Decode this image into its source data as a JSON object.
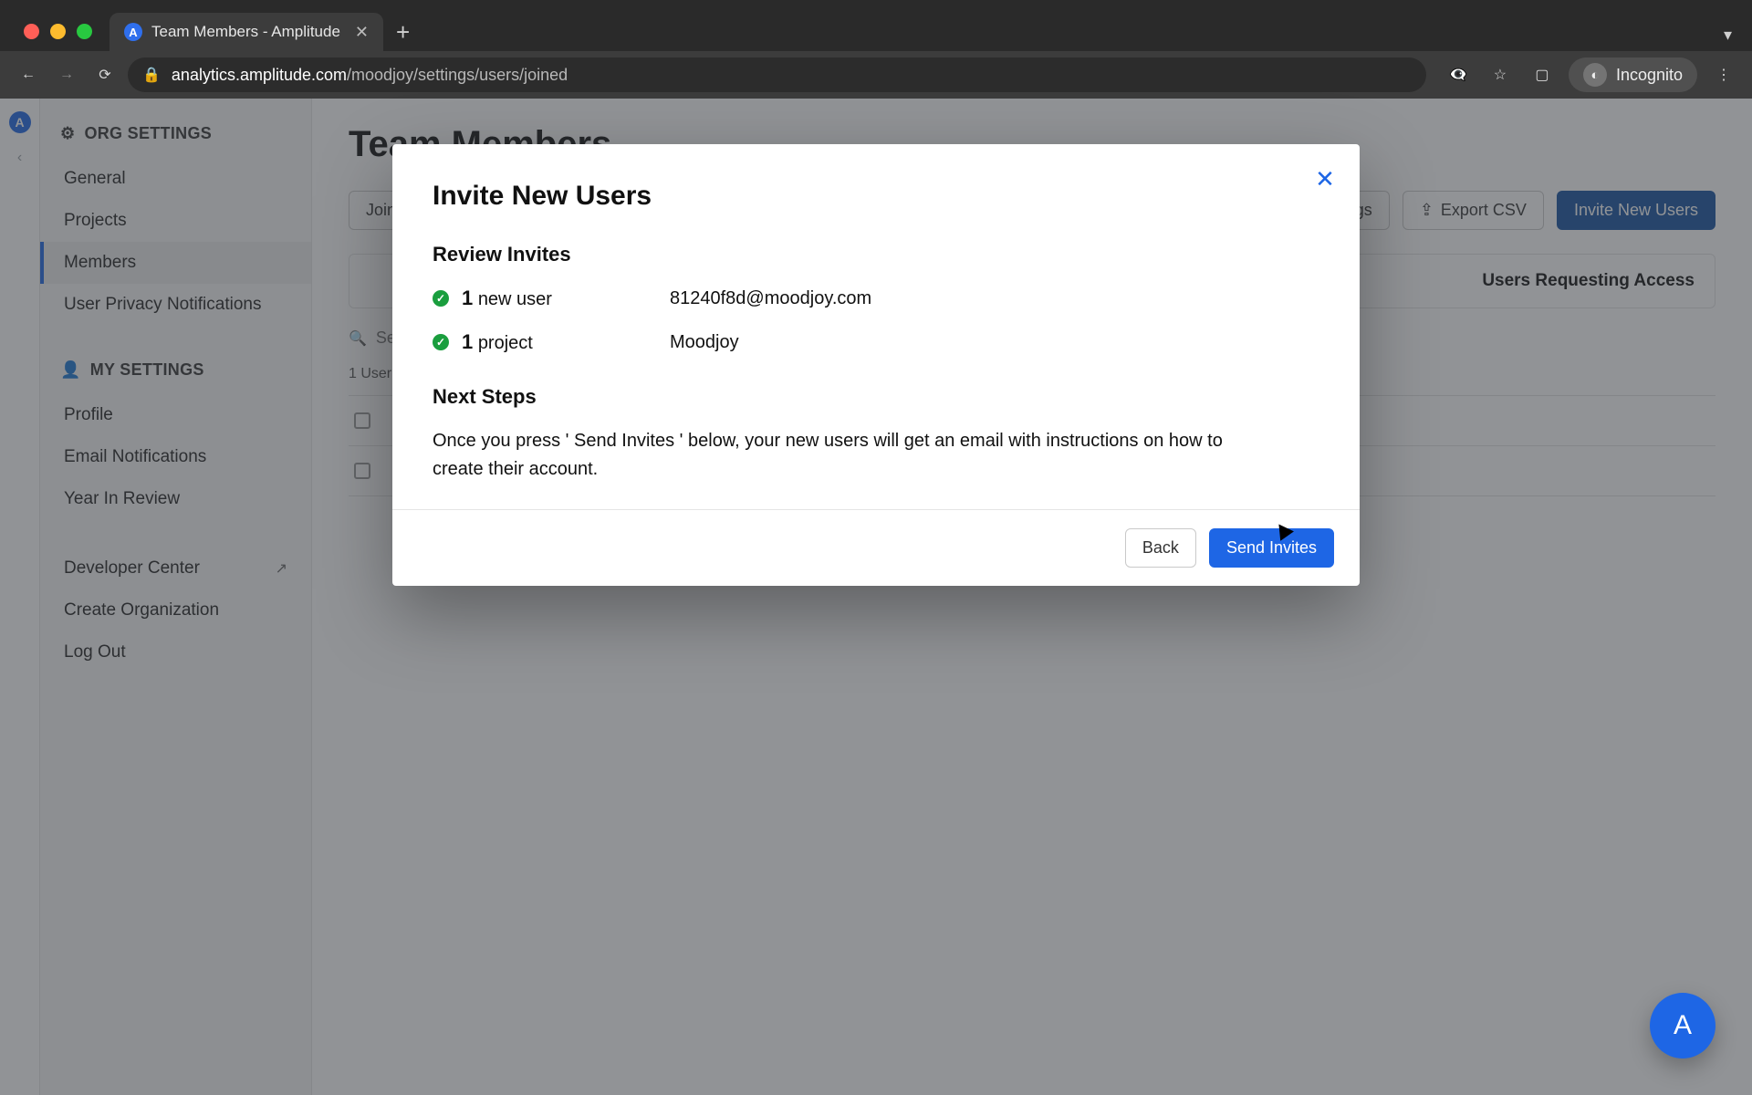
{
  "window": {
    "tab_title": "Team Members - Amplitude",
    "url_host": "analytics.amplitude.com",
    "url_path": "/moodjoy/settings/users/joined",
    "incognito_label": "Incognito"
  },
  "sidebar": {
    "org_header": "ORG SETTINGS",
    "my_header": "MY SETTINGS",
    "items_org": [
      "General",
      "Projects",
      "Members",
      "User Privacy Notifications"
    ],
    "items_my": [
      "Profile",
      "Email Notifications",
      "Year In Review"
    ],
    "items_footer": [
      "Developer Center",
      "Create Organization",
      "Log Out"
    ]
  },
  "main": {
    "title": "Team Members",
    "joined_tab": "Joined",
    "settings_btn": "Settings",
    "export_btn": "Export CSV",
    "invite_btn": "Invite New Users",
    "panel_header": "Users Requesting Access",
    "user_count_label": "1 User",
    "search_placeholder": "Search"
  },
  "modal": {
    "title": "Invite New Users",
    "review_header": "Review Invites",
    "rows": [
      {
        "count": "1",
        "label": "new user",
        "value": "81240f8d@moodjoy.com"
      },
      {
        "count": "1",
        "label": "project",
        "value": "Moodjoy"
      }
    ],
    "next_header": "Next Steps",
    "next_body": "Once you press ' Send Invites ' below, your new users will get an email with instructions on how to create their account.",
    "back": "Back",
    "send": "Send Invites"
  },
  "colors": {
    "accent": "#1e66e5",
    "success": "#1a9e3e"
  }
}
